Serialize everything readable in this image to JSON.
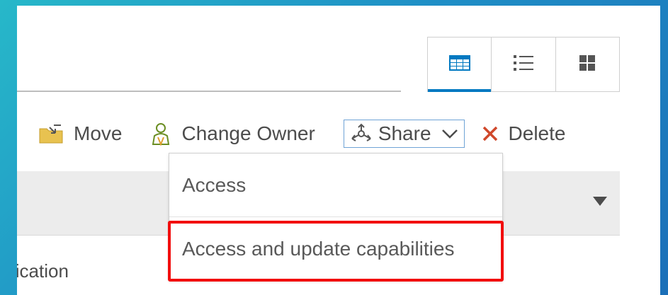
{
  "view_toggle": {
    "options": [
      {
        "icon": "table-view-icon",
        "active": true
      },
      {
        "icon": "list-view-icon",
        "active": false
      },
      {
        "icon": "grid-view-icon",
        "active": false
      }
    ],
    "accent_color": "#0079c1"
  },
  "toolbar": {
    "move_label": "Move",
    "move_icon": "folder-move-icon",
    "change_owner_label": "Change Owner",
    "change_owner_icon": "person-icon",
    "share_label": "Share",
    "share_icon": "share-icon",
    "delete_label": "Delete",
    "delete_icon": "x-delete-icon",
    "delete_color": "#d0482b"
  },
  "share_menu": {
    "items": [
      {
        "label": "Access"
      },
      {
        "label": "Access and update capabilities",
        "highlighted": true
      }
    ],
    "highlight_color": "#f20d0d"
  },
  "background_text": {
    "partial_label": "lication"
  }
}
